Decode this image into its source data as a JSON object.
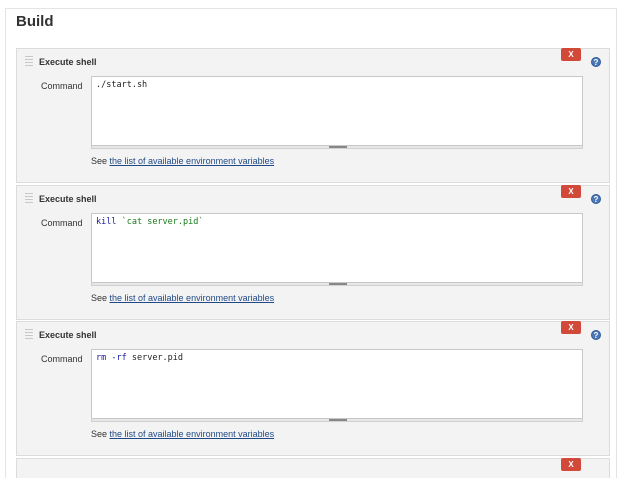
{
  "section": {
    "title": "Build"
  },
  "builders": [
    {
      "title": "Execute shell",
      "delete_label": "X",
      "help_label": "?",
      "command_label": "Command",
      "command": "./start.sh",
      "env_prefix": "See ",
      "env_link": "the list of available environment variables"
    },
    {
      "title": "Execute shell",
      "delete_label": "X",
      "help_label": "?",
      "command_label": "Command",
      "command_keyword": "kill",
      "command_string": "`cat server.pid`",
      "env_prefix": "See ",
      "env_link": "the list of available environment variables"
    },
    {
      "title": "Execute shell",
      "delete_label": "X",
      "help_label": "?",
      "command_label": "Command",
      "command_keyword": "rm -rf",
      "command_rest": "server.pid",
      "env_prefix": "See ",
      "env_link": "the list of available environment variables"
    },
    {
      "delete_label": "X"
    }
  ],
  "colors": {
    "delete_button": "#d24939",
    "help_icon": "#4a78b8",
    "link": "#204a87",
    "keyword": "#1a1a9e",
    "string": "#1a7a1a"
  }
}
